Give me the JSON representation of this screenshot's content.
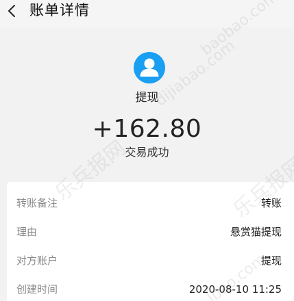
{
  "nav": {
    "title": "账单详情",
    "back_icon": "chevron-left-icon"
  },
  "summary": {
    "avatar_icon": "user-avatar-icon",
    "avatar_color": "#1a9ff2",
    "kind": "提现",
    "amount": "+162.80",
    "status": "交易成功"
  },
  "details": {
    "rows": [
      {
        "label": "转账备注",
        "value": "转账"
      },
      {
        "label": "理由",
        "value": "悬赏猫提现"
      },
      {
        "label": "对方账户",
        "value": "提现"
      },
      {
        "label": "创建时间",
        "value": "2020-08-10 11:25"
      }
    ]
  },
  "watermark": {
    "text_a": "乐兵报网",
    "text_b": "乐兵报网",
    "url_a": "lbao.com",
    "url_b": "dijiabao.com",
    "url_c": "baobao.com"
  }
}
